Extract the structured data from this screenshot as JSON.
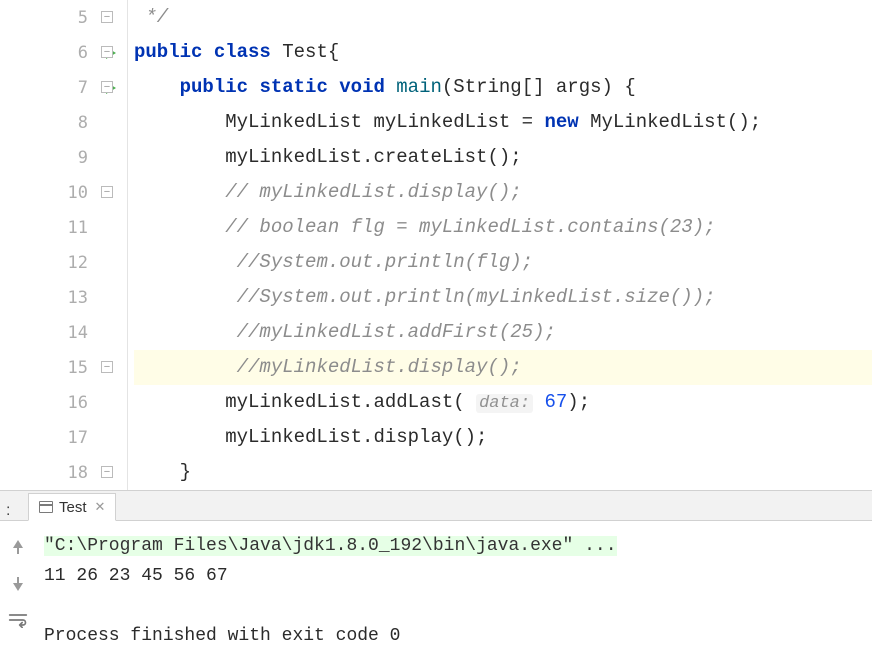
{
  "editor": {
    "lines": [
      {
        "num": "5",
        "run": false,
        "fold": "close",
        "tokens": [
          {
            "cls": "cmt",
            "t": " */"
          }
        ]
      },
      {
        "num": "6",
        "run": true,
        "fold": "open",
        "tokens": [
          {
            "cls": "kw",
            "t": "public"
          },
          {
            "cls": "",
            "t": " "
          },
          {
            "cls": "kw",
            "t": "class"
          },
          {
            "cls": "",
            "t": " Test{"
          }
        ]
      },
      {
        "num": "7",
        "run": true,
        "fold": "open",
        "tokens": [
          {
            "cls": "",
            "t": "    "
          },
          {
            "cls": "kw",
            "t": "public"
          },
          {
            "cls": "",
            "t": " "
          },
          {
            "cls": "kw",
            "t": "static"
          },
          {
            "cls": "",
            "t": " "
          },
          {
            "cls": "kw",
            "t": "void"
          },
          {
            "cls": "",
            "t": " "
          },
          {
            "cls": "mtd",
            "t": "main"
          },
          {
            "cls": "",
            "t": "(String[] args) {"
          }
        ]
      },
      {
        "num": "8",
        "run": false,
        "fold": "",
        "tokens": [
          {
            "cls": "",
            "t": "        MyLinkedList myLinkedList = "
          },
          {
            "cls": "kw",
            "t": "new"
          },
          {
            "cls": "",
            "t": " MyLinkedList();"
          }
        ]
      },
      {
        "num": "9",
        "run": false,
        "fold": "",
        "tokens": [
          {
            "cls": "",
            "t": "        myLinkedList.createList();"
          }
        ]
      },
      {
        "num": "10",
        "run": false,
        "fold": "open",
        "tokens": [
          {
            "cls": "",
            "t": "        "
          },
          {
            "cls": "cmt",
            "t": "// myLinkedList.display();"
          }
        ]
      },
      {
        "num": "11",
        "run": false,
        "fold": "",
        "tokens": [
          {
            "cls": "",
            "t": "        "
          },
          {
            "cls": "cmt",
            "t": "// boolean flg = myLinkedList.contains(23);"
          }
        ]
      },
      {
        "num": "12",
        "run": false,
        "fold": "",
        "tokens": [
          {
            "cls": "",
            "t": "         "
          },
          {
            "cls": "cmt",
            "t": "//System.out.println(flg);"
          }
        ]
      },
      {
        "num": "13",
        "run": false,
        "fold": "",
        "tokens": [
          {
            "cls": "",
            "t": "         "
          },
          {
            "cls": "cmt",
            "t": "//System.out.println(myLinkedList.size());"
          }
        ]
      },
      {
        "num": "14",
        "run": false,
        "fold": "",
        "tokens": [
          {
            "cls": "",
            "t": "         "
          },
          {
            "cls": "cmt",
            "t": "//myLinkedList.addFirst(25);"
          }
        ]
      },
      {
        "num": "15",
        "run": false,
        "fold": "close",
        "hl": true,
        "tokens": [
          {
            "cls": "",
            "t": "         "
          },
          {
            "cls": "cmt",
            "t": "//myLinkedList.display();"
          }
        ]
      },
      {
        "num": "16",
        "run": false,
        "fold": "",
        "tokens": [
          {
            "cls": "",
            "t": "        myLinkedList.addLast( "
          },
          {
            "cls": "hint",
            "t": "data:"
          },
          {
            "cls": "",
            "t": " "
          },
          {
            "cls": "num",
            "t": "67"
          },
          {
            "cls": "",
            "t": ");"
          }
        ]
      },
      {
        "num": "17",
        "run": false,
        "fold": "",
        "tokens": [
          {
            "cls": "",
            "t": "        myLinkedList.display();"
          }
        ]
      },
      {
        "num": "18",
        "run": false,
        "fold": "close",
        "tokens": [
          {
            "cls": "",
            "t": "    }"
          }
        ]
      }
    ]
  },
  "console": {
    "tab_label": "Test",
    "command": "\"C:\\Program Files\\Java\\jdk1.8.0_192\\bin\\java.exe\" ...",
    "output": "11 26 23 45 56 67",
    "exit": "Process finished with exit code 0"
  }
}
